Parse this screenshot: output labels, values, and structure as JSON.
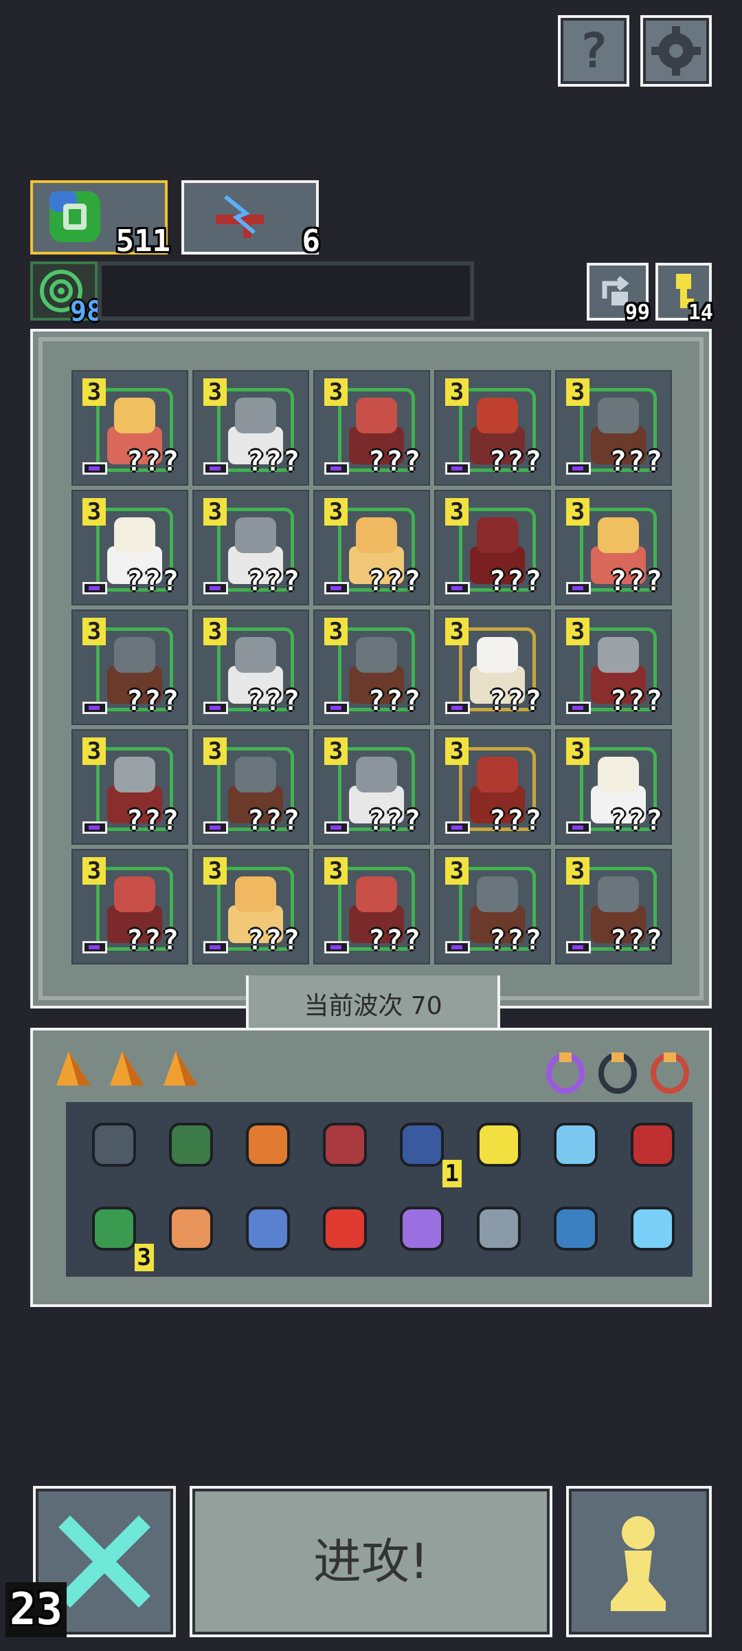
{
  "top_buttons": {
    "help_label": "?",
    "settings_icon": "gear-icon"
  },
  "resources": {
    "gem": {
      "icon": "green-gem-icon",
      "count": "511"
    },
    "weapon": {
      "icon": "weapon-icon",
      "count": "6"
    },
    "xp": {
      "icon": "target-icon",
      "level": "98",
      "progress": 0
    },
    "reroll": {
      "icon": "reroll-icon",
      "count": "99"
    },
    "key": {
      "icon": "key-icon",
      "count": "14"
    }
  },
  "units": [
    {
      "level": "3",
      "name": "???",
      "hero": "blonde-brawler"
    },
    {
      "level": "3",
      "name": "???",
      "hero": "bearded-knight"
    },
    {
      "level": "3",
      "name": "???",
      "hero": "red-bandana-fighter"
    },
    {
      "level": "3",
      "name": "???",
      "hero": "red-crowned-king"
    },
    {
      "level": "3",
      "name": "???",
      "hero": "shield-knight"
    },
    {
      "level": "3",
      "name": "???",
      "hero": "white-mage"
    },
    {
      "level": "3",
      "name": "???",
      "hero": "bearded-knight"
    },
    {
      "level": "3",
      "name": "???",
      "hero": "gold-golem"
    },
    {
      "level": "3",
      "name": "???",
      "hero": "hooded-rogue"
    },
    {
      "level": "3",
      "name": "???",
      "hero": "blonde-brawler"
    },
    {
      "level": "3",
      "name": "???",
      "hero": "shield-knight"
    },
    {
      "level": "3",
      "name": "???",
      "hero": "bearded-knight"
    },
    {
      "level": "3",
      "name": "???",
      "hero": "shield-knight"
    },
    {
      "level": "3",
      "name": "???",
      "hero": "white-haired-girl"
    },
    {
      "level": "3",
      "name": "???",
      "hero": "helmet-soldier"
    },
    {
      "level": "3",
      "name": "???",
      "hero": "helmet-soldier"
    },
    {
      "level": "3",
      "name": "???",
      "hero": "shield-knight"
    },
    {
      "level": "3",
      "name": "???",
      "hero": "bearded-knight"
    },
    {
      "level": "3",
      "name": "???",
      "hero": "red-armored-warrior"
    },
    {
      "level": "3",
      "name": "???",
      "hero": "white-mage"
    },
    {
      "level": "3",
      "name": "???",
      "hero": "red-bandana-fighter"
    },
    {
      "level": "3",
      "name": "???",
      "hero": "gold-golem"
    },
    {
      "level": "3",
      "name": "???",
      "hero": "red-bandana-fighter"
    },
    {
      "level": "3",
      "name": "???",
      "hero": "shield-knight"
    },
    {
      "level": "3",
      "name": "???",
      "hero": "shield-knight"
    }
  ],
  "wave": {
    "label": "当前波次 70"
  },
  "equip": {
    "shards": [
      "orange-shard-icon",
      "orange-shard-icon",
      "orange-shard-icon"
    ],
    "rings": [
      "purple-ring-icon",
      "dark-amulet-icon",
      "red-ring-icon"
    ]
  },
  "items": [
    {
      "icon": "shield-icon",
      "count": ""
    },
    {
      "icon": "green-helmet-icon",
      "count": ""
    },
    {
      "icon": "orange-armor-icon",
      "count": ""
    },
    {
      "icon": "dna-icon",
      "count": ""
    },
    {
      "icon": "pistol-icon",
      "count": "1"
    },
    {
      "icon": "potion-flask-icon",
      "count": ""
    },
    {
      "icon": "ice-bird-icon",
      "count": ""
    },
    {
      "icon": "crosshair-icon",
      "count": ""
    },
    {
      "icon": "green-flask-icon",
      "count": "3"
    },
    {
      "icon": "bullet-icon",
      "count": ""
    },
    {
      "icon": "blue-potion-icon",
      "count": ""
    },
    {
      "icon": "battery-icon",
      "count": ""
    },
    {
      "icon": "spark-wand-icon",
      "count": ""
    },
    {
      "icon": "stone-heart-icon",
      "count": ""
    },
    {
      "icon": "basket-icon",
      "count": ""
    },
    {
      "icon": "lightning-icon",
      "count": ""
    }
  ],
  "bottom": {
    "attack_label": "进攻!",
    "counter": "23",
    "cancel_icon": "x-icon",
    "pawn_icon": "pawn-icon"
  },
  "colors": {
    "bg": "#24252c",
    "level_badge": "#f1e240",
    "outline_green": "#3dd24a",
    "outline_gold": "#f2c230"
  }
}
